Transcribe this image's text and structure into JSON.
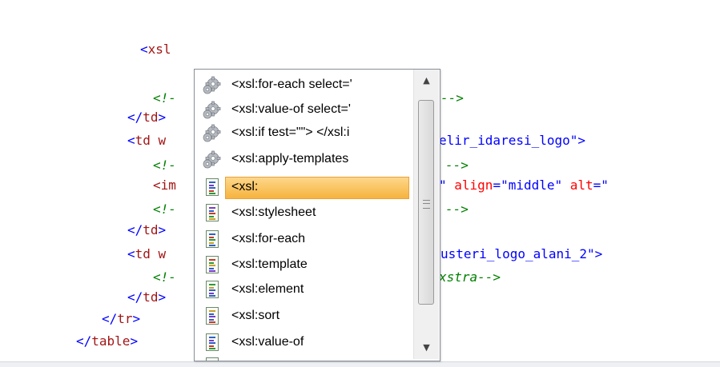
{
  "code": {
    "lines": [
      {
        "parts": [
          {
            "t": "<",
            "c": "tag"
          },
          {
            "t": "xsl",
            "c": "elem"
          }
        ]
      },
      {
        "parts": [
          {
            "t": "<!-",
            "c": "comment"
          },
          {
            "t": "-->",
            "c": "comment"
          }
        ]
      },
      {
        "parts": [
          {
            "t": "</",
            "c": "tag"
          },
          {
            "t": "td",
            "c": "elem"
          },
          {
            "t": ">",
            "c": "tag"
          }
        ]
      },
      {
        "parts": [
          {
            "t": "<",
            "c": "tag"
          },
          {
            "t": "td w",
            "c": "elem"
          },
          {
            "t": "elir_idaresi_logo\">",
            "c": "val"
          }
        ]
      },
      {
        "parts": [
          {
            "t": "<!-",
            "c": "comment"
          },
          {
            "t": "-->",
            "c": "comment"
          }
        ]
      },
      {
        "parts": [
          {
            "t": "<im",
            "c": "elem"
          },
          {
            "t": "\" ",
            "c": "val"
          },
          {
            "t": "align",
            "c": "attr"
          },
          {
            "t": "=\"middle\" ",
            "c": "val"
          },
          {
            "t": "alt",
            "c": "attr"
          },
          {
            "t": "=\"",
            "c": "val"
          }
        ]
      },
      {
        "parts": [
          {
            "t": "<!-",
            "c": "comment"
          },
          {
            "t": "-->",
            "c": "comment"
          }
        ]
      },
      {
        "parts": [
          {
            "t": "</",
            "c": "tag"
          },
          {
            "t": "td",
            "c": "elem"
          },
          {
            "t": ">",
            "c": "tag"
          }
        ]
      },
      {
        "parts": [
          {
            "t": "<",
            "c": "tag"
          },
          {
            "t": "td w",
            "c": "elem"
          },
          {
            "t": "usteri_logo_alani_2\">",
            "c": "val"
          }
        ]
      },
      {
        "parts": [
          {
            "t": "<!-",
            "c": "comment"
          },
          {
            "t": "xstra-->",
            "c": "comment"
          }
        ]
      },
      {
        "parts": [
          {
            "t": "</",
            "c": "tag"
          },
          {
            "t": "td",
            "c": "elem"
          },
          {
            "t": ">",
            "c": "tag"
          }
        ]
      },
      {
        "parts": [
          {
            "t": "</",
            "c": "tag"
          },
          {
            "t": "tr",
            "c": "elem"
          },
          {
            "t": ">",
            "c": "tag"
          }
        ]
      },
      {
        "parts": [
          {
            "t": "</",
            "c": "tag"
          },
          {
            "t": "table",
            "c": "elem"
          },
          {
            "t": ">",
            "c": "tag"
          }
        ]
      }
    ]
  },
  "autocomplete": {
    "items": [
      {
        "label": "<xsl:for-each select='",
        "icon": "gear-icon",
        "selected": false
      },
      {
        "label": "<xsl:value-of select='",
        "icon": "gear-icon",
        "selected": false
      },
      {
        "label": "<xsl:if test=\"\">  </xsl:i",
        "icon": "gear-icon",
        "selected": false
      },
      {
        "label": "<xsl:apply-templates",
        "icon": "gear-icon",
        "selected": false
      },
      {
        "label": "<xsl:",
        "icon": "document-icon",
        "selected": true
      },
      {
        "label": "<xsl:stylesheet",
        "icon": "document-icon",
        "selected": false
      },
      {
        "label": "<xsl:for-each",
        "icon": "document-icon",
        "selected": false
      },
      {
        "label": "<xsl:template",
        "icon": "document-icon",
        "selected": false
      },
      {
        "label": "<xsl:element",
        "icon": "document-icon",
        "selected": false
      },
      {
        "label": "<xsl:sort",
        "icon": "document-icon",
        "selected": false
      },
      {
        "label": "<xsl:value-of",
        "icon": "document-icon",
        "selected": false
      },
      {
        "label": "",
        "icon": "document-icon",
        "selected": false
      }
    ],
    "scrollbar": {
      "up_icon": "scroll-up-arrow-icon",
      "down_icon": "scroll-down-arrow-icon"
    }
  },
  "colors": {
    "tag": "#0000ff",
    "element": "#a31515",
    "attribute": "#ff0000",
    "comment": "#008000",
    "selection": "#f6b33e"
  }
}
